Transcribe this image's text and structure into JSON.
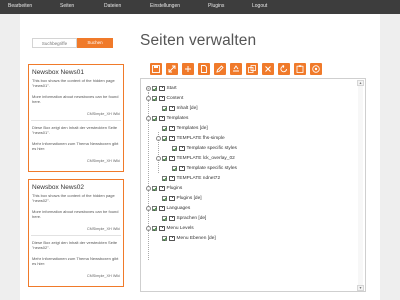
{
  "topnav": {
    "items": [
      "Bearbeiten",
      "Seiten",
      "Dateien",
      "Einstellungen",
      "Plugins",
      "Logout"
    ]
  },
  "search": {
    "placeholder": "Suchbegriffe",
    "button_label": "Suchen"
  },
  "newsboxes": [
    {
      "title": "Newsbox News01",
      "intro": "This box shows the content of the hidden page \"news01\".",
      "more_info": "More information about newsboxes can be found here.",
      "link": "CMSimple_XH Wiki",
      "de_intro": "Diese Box zeigt den Inhalt der versteckten Seite \"news01\".",
      "de_more_info": "Mehr Informationen zum Thema Newsboxen gibt es hier:",
      "de_link": "CMSimple_XH Wiki"
    },
    {
      "title": "Newsbox News02",
      "intro": "This box shows the content of the hidden page \"news02\".",
      "more_info": "More information about newsboxes can be found here.",
      "link": "CMSimple_XH Wiki",
      "de_intro": "Diese Box zeigt den Inhalt der versteckten Seite \"news02\".",
      "de_more_info": "Mehr Informationen zum Thema Newsboxen gibt es hier:",
      "de_link": "CMSimple_XH Wiki"
    }
  ],
  "main": {
    "title": "Seiten verwalten"
  },
  "toolbar": {
    "buttons": [
      "save-icon",
      "expand-icon",
      "collapse-icon",
      "new-page-icon",
      "edit-icon",
      "rename-icon",
      "copy-icon",
      "delete-icon",
      "undo-icon",
      "paste-icon",
      "help-icon"
    ],
    "accent": "#f07a2a"
  },
  "tree": {
    "nodes": [
      {
        "label": "Start",
        "toggle": "+"
      },
      {
        "label": "Content",
        "toggle": "-"
      },
      {
        "label": "Inhalt [de]",
        "toggle": ""
      },
      {
        "label": "Templates",
        "toggle": "-"
      },
      {
        "label": "Templates [de]",
        "toggle": ""
      },
      {
        "label": "TEMPLATE fhs-simple",
        "toggle": "-"
      },
      {
        "label": "Template specific styles",
        "toggle": ""
      },
      {
        "label": "TEMPLATE lck_overlay_02",
        "toggle": "-"
      },
      {
        "label": "Template specific styles",
        "toggle": ""
      },
      {
        "label": "TEMPLATE ndnet72",
        "toggle": ""
      },
      {
        "label": "Plugins",
        "toggle": "-"
      },
      {
        "label": "Plugins [de]",
        "toggle": ""
      },
      {
        "label": "Languages",
        "toggle": "-"
      },
      {
        "label": "Sprachen [de]",
        "toggle": ""
      },
      {
        "label": "Menu Levels",
        "toggle": "-"
      },
      {
        "label": "Menu Ebenen [de]",
        "toggle": ""
      }
    ]
  }
}
